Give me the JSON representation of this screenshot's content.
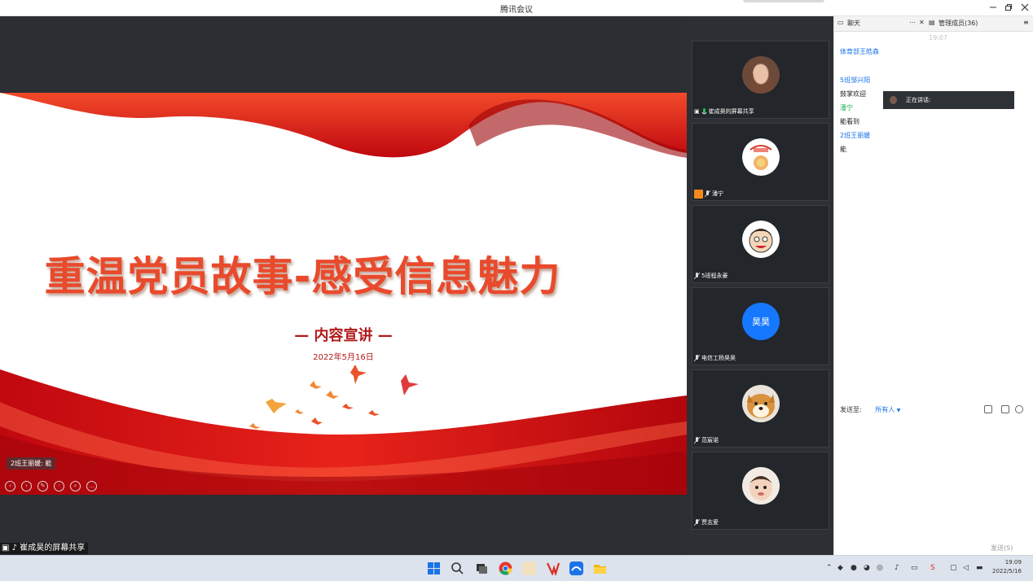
{
  "window": {
    "title": "腾讯会议",
    "minimize_icon": "minimize-icon",
    "restore_icon": "restore-icon",
    "close_icon": "close-icon"
  },
  "slide": {
    "headline": "重温党员故事-感受信息魅力",
    "subtitle": "— 内容宣讲 —",
    "date": "2022年5月16日",
    "annotation_name": "2班王丽媛:",
    "annotation_text": "能",
    "accent_color": "#d9121b"
  },
  "share_label": "崔成昊的屏幕共享",
  "participants": [
    {
      "name": "崔成昊的屏幕共享",
      "avatar": "woman-photo"
    },
    {
      "name": "潘宁",
      "avatar": "food-cartoon"
    },
    {
      "name": "5班程永豪",
      "avatar": "cartoon-face"
    },
    {
      "name": "电信工杨昊昊",
      "avatar": "text-avatar",
      "avatar_text": "昊昊",
      "avatar_color": "#1677ff"
    },
    {
      "name": "范宸诺",
      "avatar": "shiba-dog"
    },
    {
      "name": "贾志爱",
      "avatar": "child-photo"
    }
  ],
  "chat": {
    "tab_chat": "聊天",
    "tab_members": "管理成员(36)",
    "time": "19:07",
    "messages": [
      {
        "sender": "体育部王皓森",
        "text": ""
      },
      {
        "sender": "5班邹兴阳",
        "text": "鼓掌欢迎"
      },
      {
        "sender": "潘宁",
        "text": "能看到"
      },
      {
        "sender": "2班王丽媛",
        "text": "能"
      }
    ],
    "speaking_label": "正在讲话:",
    "send_to_label": "发送至:",
    "send_to_value": "所有人",
    "send_button": "发送(S)"
  },
  "taskbar": {
    "clock_time": "19:09",
    "clock_date": "2022/5/16",
    "apps": [
      "windows-start-icon",
      "search-icon",
      "task-view-icon",
      "chrome-icon",
      "game-icon",
      "wps-icon",
      "tencent-meeting-icon",
      "file-explorer-icon"
    ]
  }
}
